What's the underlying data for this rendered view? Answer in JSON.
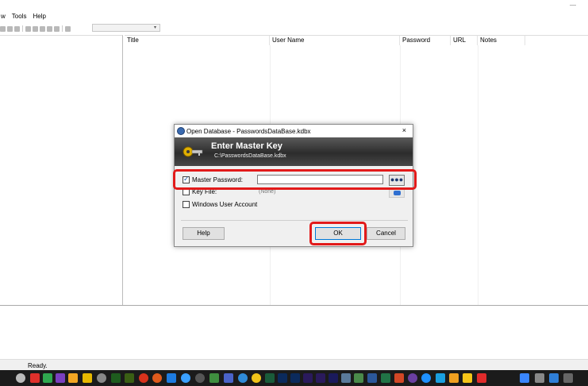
{
  "window": {
    "minimize_glyph": "—"
  },
  "menu": [
    "w",
    "Tools",
    "Help"
  ],
  "toolbar": {
    "icons": [
      "open-icon",
      "save-icon",
      "sync-icon",
      "add-entry-icon",
      "edit-entry-icon",
      "delete-entry-icon",
      "find-icon",
      "copy-icon",
      "lock-icon"
    ],
    "combo_arrow": "▾"
  },
  "grid": {
    "columns": [
      "Title",
      "User Name",
      "Password",
      "URL",
      "Notes"
    ]
  },
  "status": {
    "text": "Ready."
  },
  "dialog": {
    "title": "Open Database - PasswordsDataBase.kdbx",
    "close": "×",
    "banner_title": "Enter Master Key",
    "banner_path": "C:\\PasswordsDataBase.kdbx",
    "master_password_label": "Master Password:",
    "master_password_value": "",
    "reveal_label": "●●●",
    "key_file_label": "Key File:",
    "key_file_value": "(None)",
    "windows_account_label": "Windows User Account",
    "help_label": "Help",
    "ok_label": "OK",
    "cancel_label": "Cancel"
  },
  "colors": {
    "highlight": "#e21a1a",
    "banner_dark": "#2c2c2c",
    "accent": "#0078d7"
  }
}
